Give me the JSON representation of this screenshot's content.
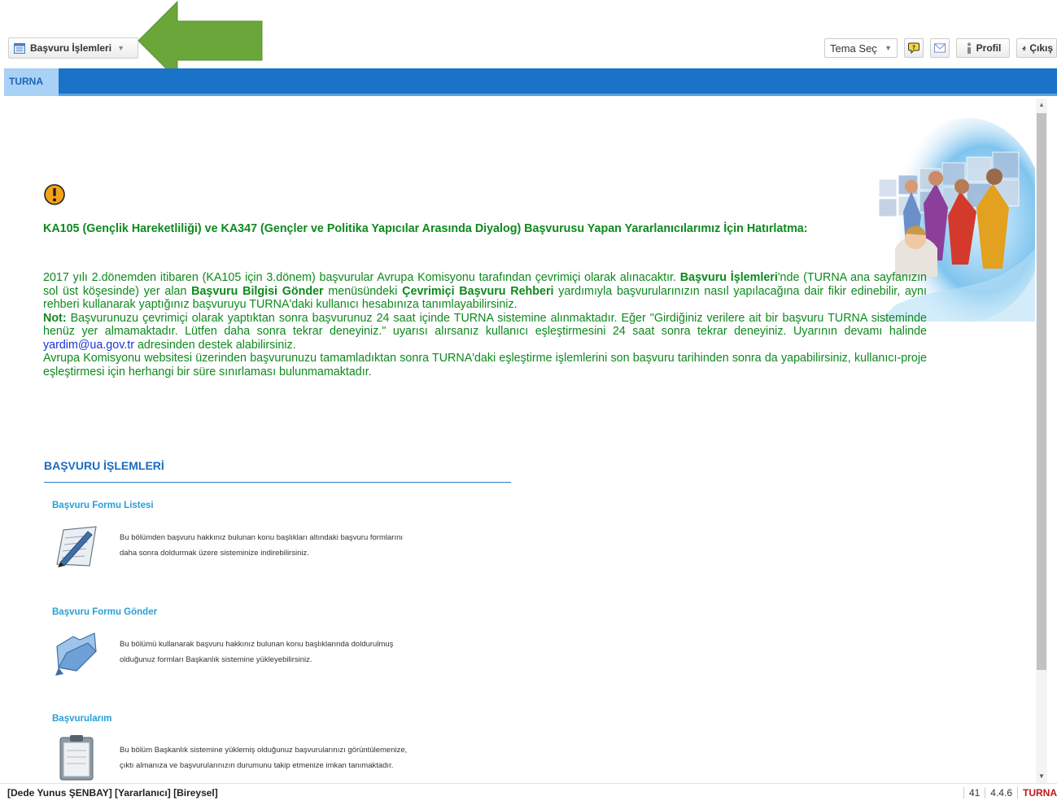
{
  "toolbar": {
    "app_menu_label": "Başvuru İşlemleri",
    "theme_select_value": "Tema Seç",
    "profile_label": "Profil",
    "logout_label": "Çıkış"
  },
  "tabs": [
    {
      "label": "TURNA",
      "active": true
    }
  ],
  "announcement": {
    "title": "KA105 (Gençlik Hareketliliği) ve KA347 (Gençler ve Politika Yapıcılar Arasında Diyalog) Başvurusu Yapan Yararlanıcılarımız İçin Hatırlatma:",
    "p1_a": "2017 yılı 2.dönemden itibaren (KA105 için 3.dönem) başvurular Avrupa Komisyonu tarafından çevrimiçi olarak alınacaktır. ",
    "p1_b": "Başvuru İşlemleri",
    "p1_c": "'nde (TURNA ana sayfanızın sol üst köşesinde) yer alan ",
    "p1_d": "Başvuru Bilgisi Gönder",
    "p1_e": " menüsündeki ",
    "p1_f": "Çevrimiçi Başvuru Rehberi",
    "p1_g": " yardımıyla başvurularınızın nasıl yapılacağına dair fikir edinebilir, aynı rehberi kullanarak yaptığınız başvuruyu TURNA'daki kullanıcı hesabınıza tanımlayabilirsiniz.",
    "note_label": "Not:",
    "note_a": " Başvurunuzu çevrimiçi olarak yaptıktan sonra başvurunuz 24 saat içinde TURNA sistemine alınmaktadır. Eğer \"Girdiğiniz verilere ait bir başvuru TURNA sisteminde henüz yer almamaktadır. Lütfen daha sonra tekrar deneyiniz.\" uyarısı alırsanız kullanıcı eşleştirmesini 24 saat sonra tekrar deneyiniz. Uyarının devamı halinde ",
    "email": "yardim@ua.gov.tr",
    "note_b": " adresinden destek alabilirsiniz.",
    "p3": "Avrupa Komisyonu websitesi üzerinden başvurunuzu tamamladıktan sonra TURNA'daki eşleştirme işlemlerini son başvuru tarihinden sonra da yapabilirsiniz, kullanıcı-proje eşleştirmesi için herhangi bir süre sınırlaması bulunmamaktadır."
  },
  "section": {
    "title": "BAŞVURU İŞLEMLERİ",
    "items": [
      {
        "title": "Başvuru Formu Listesi",
        "icon": "pen-paper-icon",
        "desc_line1": "Bu bölümden başvuru hakkınız bulunan konu başlıkları altındaki başvuru formlarını",
        "desc_line2": "daha sonra doldurmak üzere sisteminize indirebilirsiniz."
      },
      {
        "title": "Başvuru Formu Gönder",
        "icon": "folder-send-icon",
        "desc_line1": "Bu bölümü kullanarak başvuru hakkınız bulunan konu başlıklarında doldurulmuş",
        "desc_line2": "olduğunuz formları Başkanlık sistemine yükleyebilirsiniz."
      },
      {
        "title": "Başvurularım",
        "icon": "clipboard-icon",
        "desc_line1": "Bu bölüm Başkanlık sistemine yüklemiş olduğunuz başvurularınızı görüntülemenize,",
        "desc_line2": "çıktı almanıza ve başvurularınızın durumunu takip etmenize imkan tanımaktadır."
      }
    ]
  },
  "status": {
    "user": "[Dede Yunus ŞENBAY] [Yararlanıcı] [Bireysel]",
    "count": "41",
    "version": "4.4.6",
    "brand": "TURNA"
  },
  "colors": {
    "tabbar": "#1a73c9",
    "announcement_green": "#0d8a1d",
    "section_blue": "#1b6cc0",
    "item_title_blue": "#26a0d8",
    "annotation_arrow": "#6aa63a"
  }
}
